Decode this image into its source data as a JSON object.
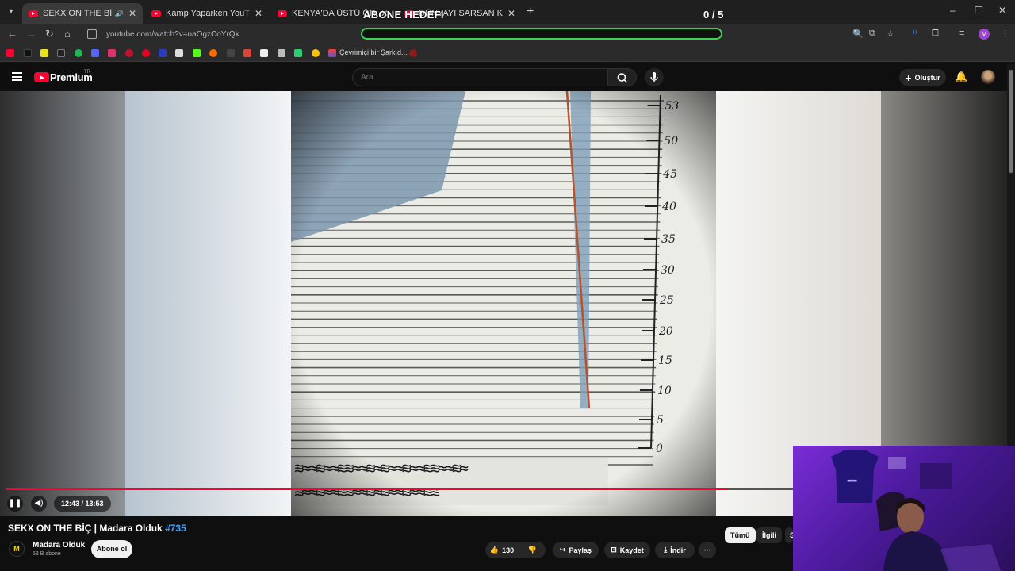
{
  "browser": {
    "tabs": [
      {
        "title": "SEKX ON THE BİÇ | Madara",
        "active": true,
        "close": "✕",
        "audio": "🔊"
      },
      {
        "title": "Kamp Yaparken YouTuberların İ",
        "close": "✕"
      },
      {
        "title": "KENYA'DA ÜSTÜ ÖRTÜLEN KO",
        "close": "✕"
      },
      {
        "title": "DÜNYAYI SARSAN KARANLIK A",
        "close": "✕"
      }
    ],
    "new_tab": "+",
    "url": "youtube.com/watch?v=naOgzCoYrQk",
    "window_controls": [
      "–",
      "❐",
      "✕"
    ],
    "profile_letter": "M",
    "bookmark_label": "Çevrimiçi bir Şarkıd..."
  },
  "overlay": {
    "goal_title": "ABONE HEDEFİ",
    "goal_count": "0 / 5",
    "goal_progress": 0,
    "goal_color": "#39d353"
  },
  "youtube": {
    "logo_text": "Premium",
    "region": "TR",
    "search_placeholder": "Ara",
    "create_label": "Oluştur",
    "brand_color": "#ff0033"
  },
  "player": {
    "current_time": "12:43",
    "duration": "13:53",
    "time_display": "12:43 / 13:53",
    "progress": 0.916,
    "scale_labels": [
      "53",
      "50",
      "45",
      "40",
      "35",
      "30",
      "25",
      "20",
      "15",
      "10",
      "5",
      "0"
    ]
  },
  "video": {
    "title": "SEKX ON THE BİÇ | Madara Olduk",
    "episode_tag": "#735",
    "channel_name": "Madara Olduk",
    "channel_initials": "M",
    "subscribers": "58 B abone",
    "subscribe_label": "Abone ol",
    "like_count": "130",
    "share_label": "Paylaş",
    "save_label": "Kaydet",
    "download_label": "İndir",
    "more_label": "⋯"
  },
  "chips": [
    "Tümü",
    "İlgili",
    "S"
  ]
}
